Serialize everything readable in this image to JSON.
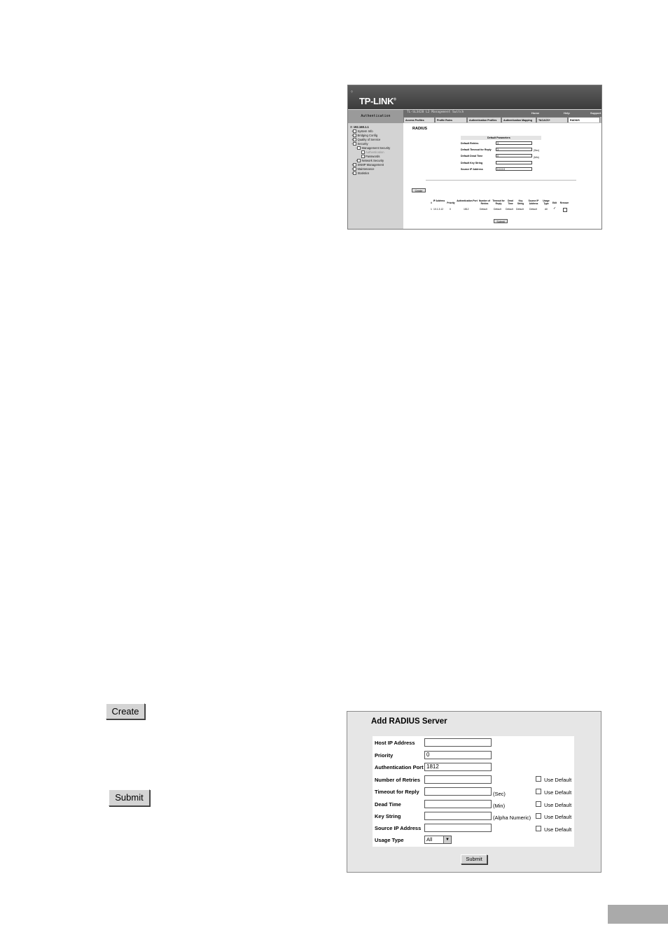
{
  "shot1": {
    "logo": "TP-LINK",
    "logo_mark": "®",
    "side_title": "Authentication",
    "switch_title": "TL-SL3428 L2 Management Switch",
    "top_links": [
      "Home",
      "Help",
      "Support"
    ],
    "tabs": [
      "Access Profiles",
      "Profile Rules",
      "Authentication Profiles",
      "Authentication Mapping",
      "TACACS+",
      "RADIUS"
    ],
    "tree": {
      "root": "192.168.1.1",
      "items": [
        "System Info",
        "Bridging Config",
        "Quality of Service",
        "Security",
        "Management Security",
        "Authentication",
        "Passwords",
        "Network Security",
        "SNMP Management",
        "Maintenance",
        "Statistics"
      ]
    },
    "page_title": "RADIUS",
    "section_title": "Default Parameters",
    "params": [
      {
        "label": "Default Retries",
        "value": "3",
        "unit": ""
      },
      {
        "label": "Default Timeout for Reply",
        "value": "3",
        "unit": "(Sec)"
      },
      {
        "label": "Default Dead Time",
        "value": "0",
        "unit": "(Min)"
      },
      {
        "label": "Default Key String",
        "value": "",
        "unit": ""
      },
      {
        "label": "Source IP Address",
        "value": "0.0.0.0",
        "unit": ""
      }
    ],
    "create_label": "Create",
    "table": {
      "headers": [
        "#",
        "IP Address",
        "Priority",
        "Authentication Port",
        "Number of Retries",
        "Timeout for Reply",
        "Dead Time",
        "Key String",
        "Source IP Address",
        "Usage Type",
        "Edit",
        "Remove"
      ],
      "row": [
        "1",
        "10.1.3.12",
        "0",
        "1812",
        "Default",
        "Default",
        "Default",
        "Default",
        "Default",
        "All",
        "✓",
        ""
      ]
    },
    "submit_label": "Submit"
  },
  "left_buttons": {
    "create": "Create",
    "submit": "Submit"
  },
  "dialog": {
    "title": "Add RADIUS Server",
    "fields": [
      {
        "label": "Host IP Address",
        "value": "",
        "unit": "",
        "use_default": ""
      },
      {
        "label": "Priority",
        "value": "0",
        "unit": "",
        "use_default": ""
      },
      {
        "label": "Authentication Port",
        "value": "1812",
        "unit": "",
        "use_default": ""
      },
      {
        "label": "Number of Retries",
        "value": "",
        "unit": "",
        "use_default": "Use Default"
      },
      {
        "label": "Timeout for Reply",
        "value": "",
        "unit": "(Sec)",
        "use_default": "Use Default"
      },
      {
        "label": "Dead Time",
        "value": "",
        "unit": "(Min)",
        "use_default": "Use Default"
      },
      {
        "label": "Key String",
        "value": "",
        "unit": "(Alpha Numeric)",
        "use_default": "Use Default"
      },
      {
        "label": "Source IP Address",
        "value": "",
        "unit": "",
        "use_default": "Use Default"
      }
    ],
    "usage_label": "Usage Type",
    "usage_value": "All",
    "submit_label": "Submit"
  }
}
